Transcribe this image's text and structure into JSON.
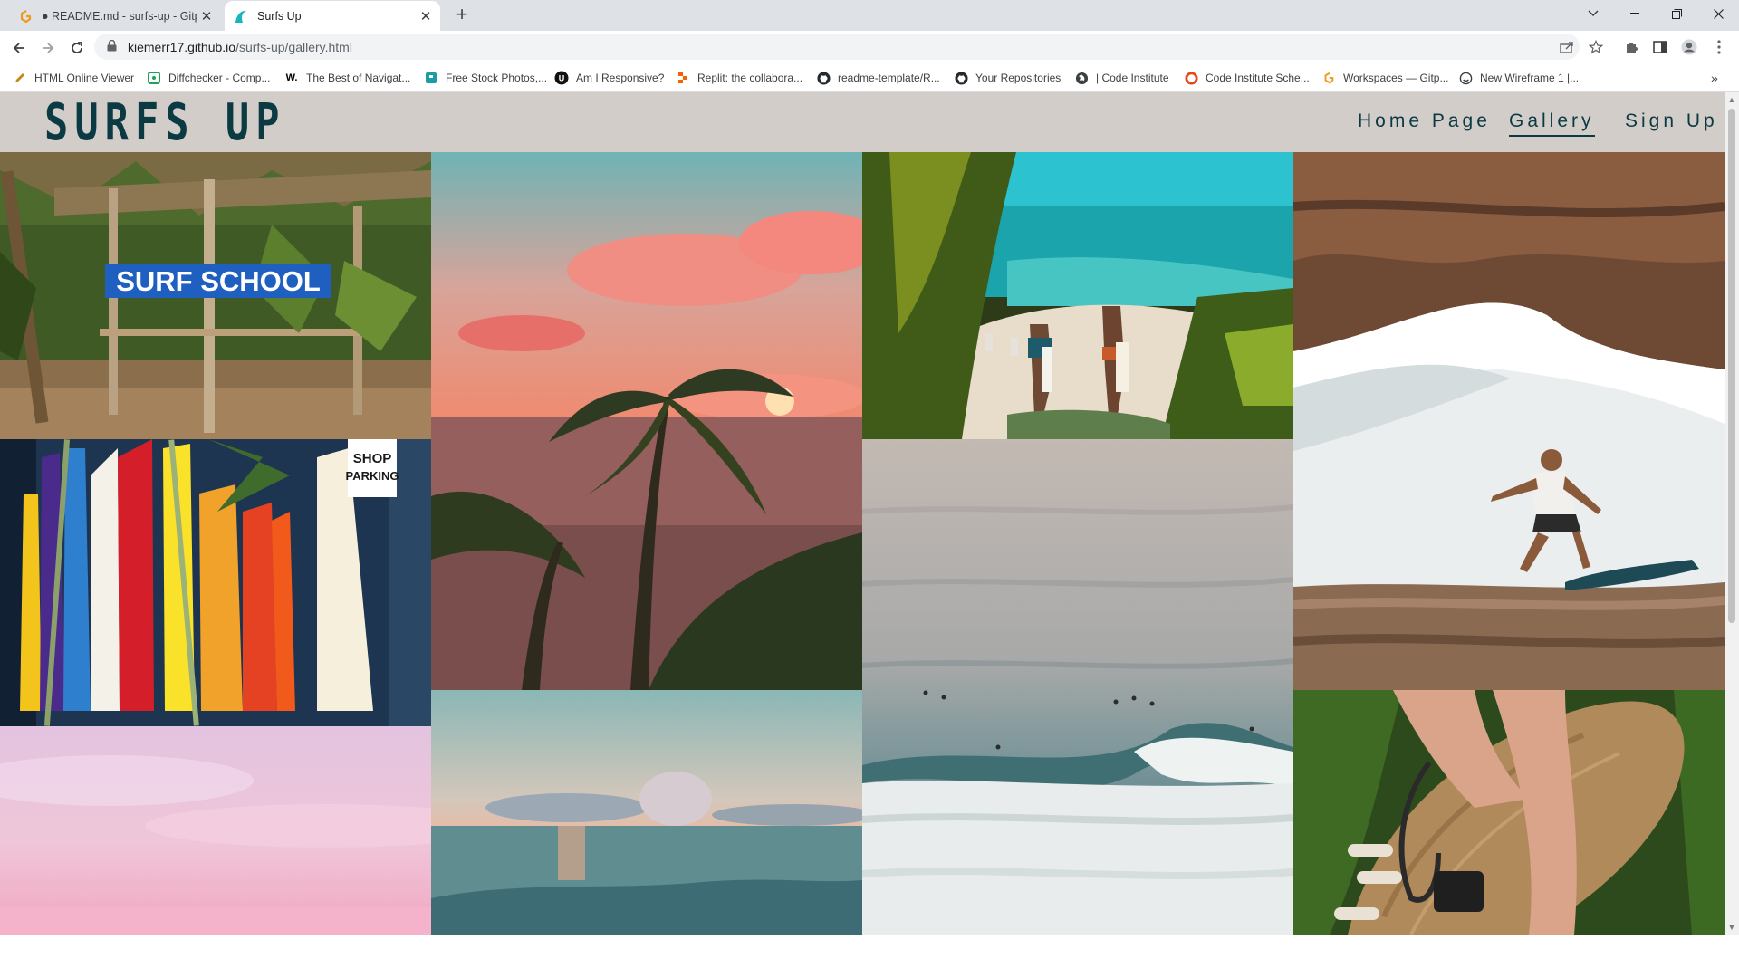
{
  "browser": {
    "tabs": [
      {
        "title": "● README.md - surfs-up - Gitpod",
        "state": "inactive"
      },
      {
        "title": "Surfs Up",
        "state": "active"
      }
    ],
    "address": {
      "host": "kiemerr17.github.io",
      "path": "/surfs-up/gallery.html"
    },
    "bookmarks": [
      "HTML Online Viewer",
      "Diffchecker - Comp...",
      "The Best of Navigat...",
      "Free Stock Photos,...",
      "Am I Responsive?",
      "Replit: the collabora...",
      "readme-template/R...",
      "Your Repositories",
      "| Code Institute",
      "Code Institute Sche...",
      "Workspaces — Gitp...",
      "New Wireframe 1 |..."
    ]
  },
  "site": {
    "brand": "SURFS UP",
    "nav": [
      {
        "label": "Home Page",
        "current": false
      },
      {
        "label": "Gallery",
        "current": true
      },
      {
        "label": "Sign Up",
        "current": false
      }
    ]
  },
  "gallery": {
    "photos": [
      {
        "name": "surf-school-sign",
        "sign_text": "SURF SCHOOL"
      },
      {
        "name": "surfboard-rack",
        "sign_text": "SHOP PARKING"
      },
      {
        "name": "pink-sky"
      },
      {
        "name": "palm-sunset"
      },
      {
        "name": "calm-ocean-dusk"
      },
      {
        "name": "beach-walkers"
      },
      {
        "name": "aerial-waves"
      },
      {
        "name": "surfer-barrel"
      },
      {
        "name": "surfboard-carry"
      }
    ]
  },
  "colors": {
    "header_bg": "#d2cdc8",
    "brand_text": "#0c3a43",
    "tabstrip_bg": "#dee1e6"
  }
}
